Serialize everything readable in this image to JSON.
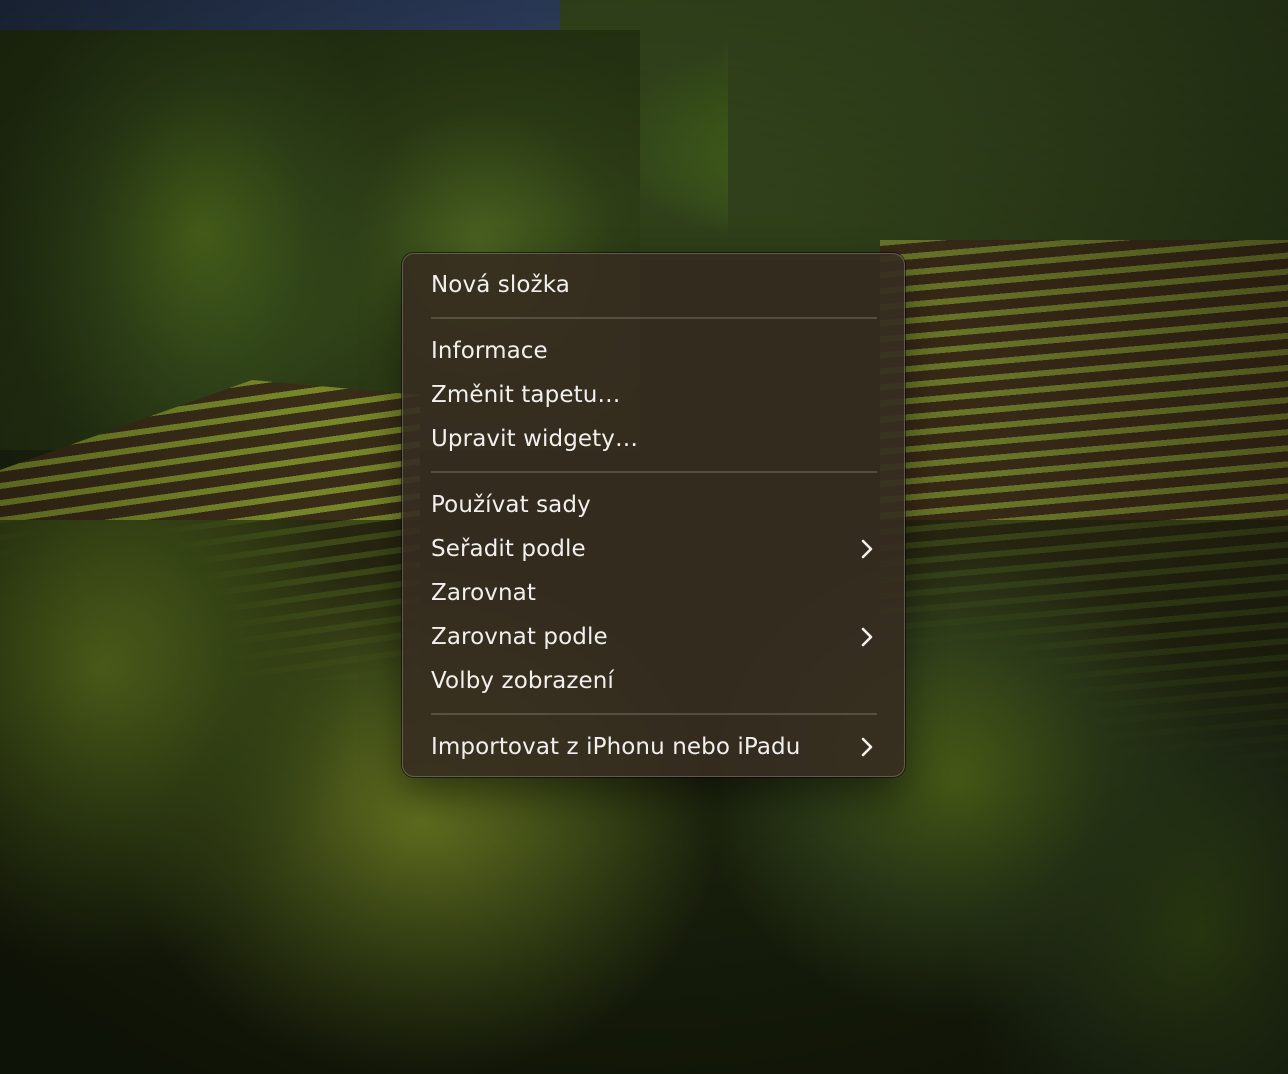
{
  "menu": {
    "groups": [
      {
        "items": [
          {
            "label": "Nová složka",
            "has_submenu": false
          }
        ]
      },
      {
        "items": [
          {
            "label": "Informace",
            "has_submenu": false
          },
          {
            "label": "Změnit tapetu…",
            "has_submenu": false
          },
          {
            "label": "Upravit widgety…",
            "has_submenu": false
          }
        ]
      },
      {
        "items": [
          {
            "label": "Používat sady",
            "has_submenu": false
          },
          {
            "label": "Seřadit podle",
            "has_submenu": true
          },
          {
            "label": "Zarovnat",
            "has_submenu": false
          },
          {
            "label": "Zarovnat podle",
            "has_submenu": true
          },
          {
            "label": "Volby zobrazení",
            "has_submenu": false
          }
        ]
      },
      {
        "items": [
          {
            "label": "Importovat z iPhonu nebo iPadu",
            "has_submenu": true
          }
        ]
      }
    ]
  },
  "icons": {
    "submenu": "chevron-right-icon"
  },
  "colors": {
    "menu_background": "#362c20",
    "menu_text": "#f2f0ee",
    "separator": "#5a5048"
  }
}
